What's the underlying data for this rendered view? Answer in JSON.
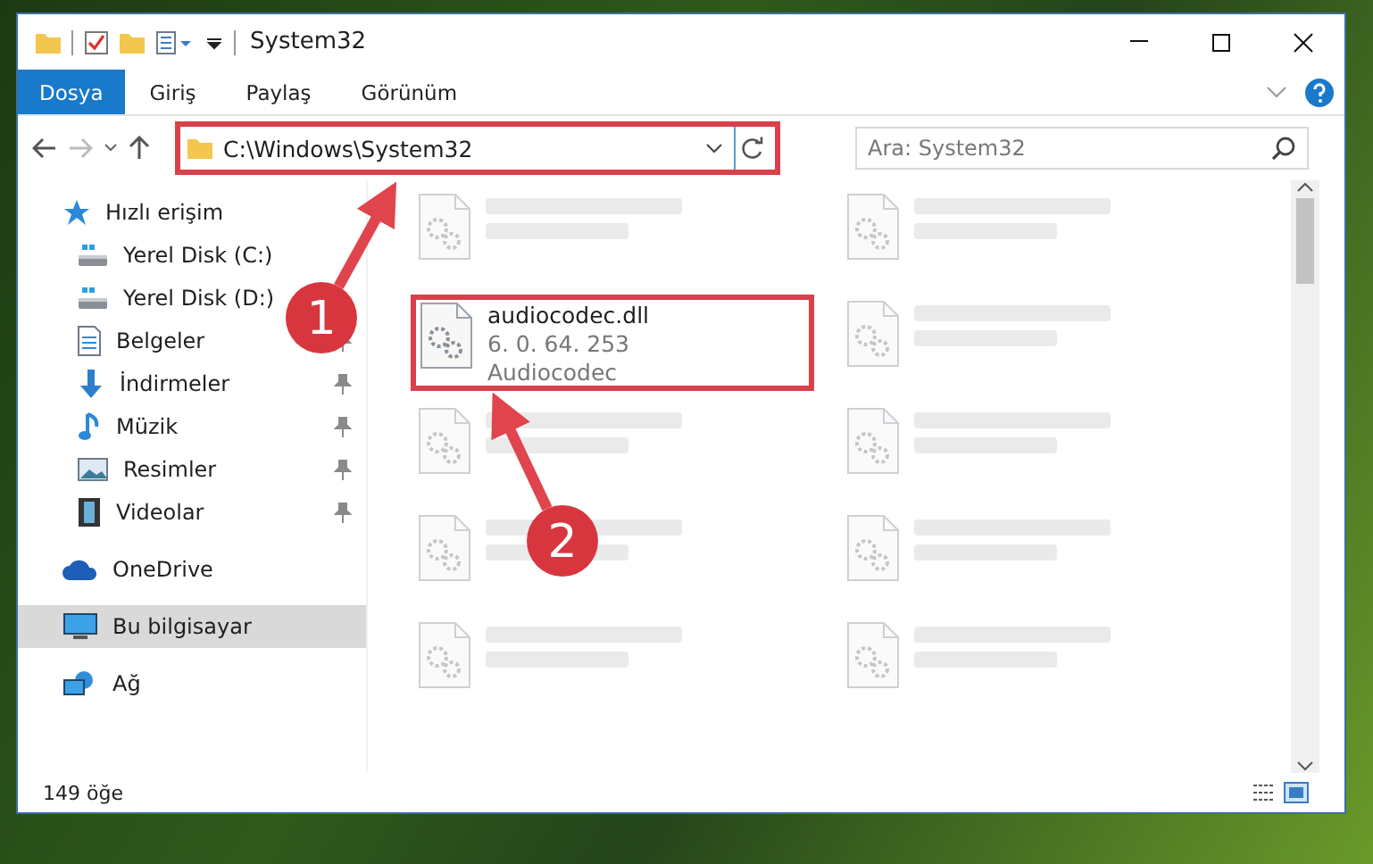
{
  "window": {
    "title": "System32"
  },
  "ribbon_tabs": [
    {
      "label": "Dosya",
      "selected": true
    },
    {
      "label": "Giriş",
      "selected": false
    },
    {
      "label": "Paylaş",
      "selected": false
    },
    {
      "label": "Görünüm",
      "selected": false
    }
  ],
  "address_bar": {
    "path": "C:\\Windows\\System32",
    "highlighted": true
  },
  "search": {
    "placeholder": "Ara: System32"
  },
  "sidebar": {
    "items": [
      {
        "label": "Hızlı erişim",
        "kind": "star",
        "selected": false,
        "children": [
          {
            "label": "Yerel Disk (C:)",
            "kind": "drive",
            "selected": false
          },
          {
            "label": "Yerel Disk (D:)",
            "kind": "drive",
            "selected": false
          },
          {
            "label": "Belgeler",
            "kind": "docs",
            "pinned": true,
            "selected": false
          },
          {
            "label": "İndirmeler",
            "kind": "download",
            "pinned": true,
            "selected": false
          },
          {
            "label": "Müzik",
            "kind": "music",
            "pinned": true,
            "selected": false
          },
          {
            "label": "Resimler",
            "kind": "pictures",
            "pinned": true,
            "selected": false
          },
          {
            "label": "Videolar",
            "kind": "video",
            "pinned": true,
            "selected": false
          }
        ]
      },
      {
        "label": "OneDrive",
        "kind": "cloud",
        "selected": false
      },
      {
        "label": "Bu bilgisayar",
        "kind": "pc",
        "selected": true
      },
      {
        "label": "Ağ",
        "kind": "network",
        "selected": false
      }
    ]
  },
  "files": [
    {
      "blurred": true,
      "highlighted": false
    },
    {
      "blurred": true,
      "highlighted": false
    },
    {
      "name": "audiocodec.dll",
      "line_2": "6. 0. 64. 253",
      "line_3": "Audiocodec",
      "blurred": false,
      "highlighted": true
    },
    {
      "blurred": true,
      "highlighted": false
    },
    {
      "blurred": true,
      "highlighted": false
    },
    {
      "blurred": true,
      "highlighted": false
    },
    {
      "blurred": true,
      "highlighted": false
    },
    {
      "blurred": true,
      "highlighted": false
    },
    {
      "blurred": true,
      "highlighted": false
    },
    {
      "blurred": true,
      "highlighted": false
    }
  ],
  "status_bar": {
    "item_count": "149 öğe"
  },
  "annotations": [
    {
      "label": "1"
    },
    {
      "label": "2"
    }
  ]
}
